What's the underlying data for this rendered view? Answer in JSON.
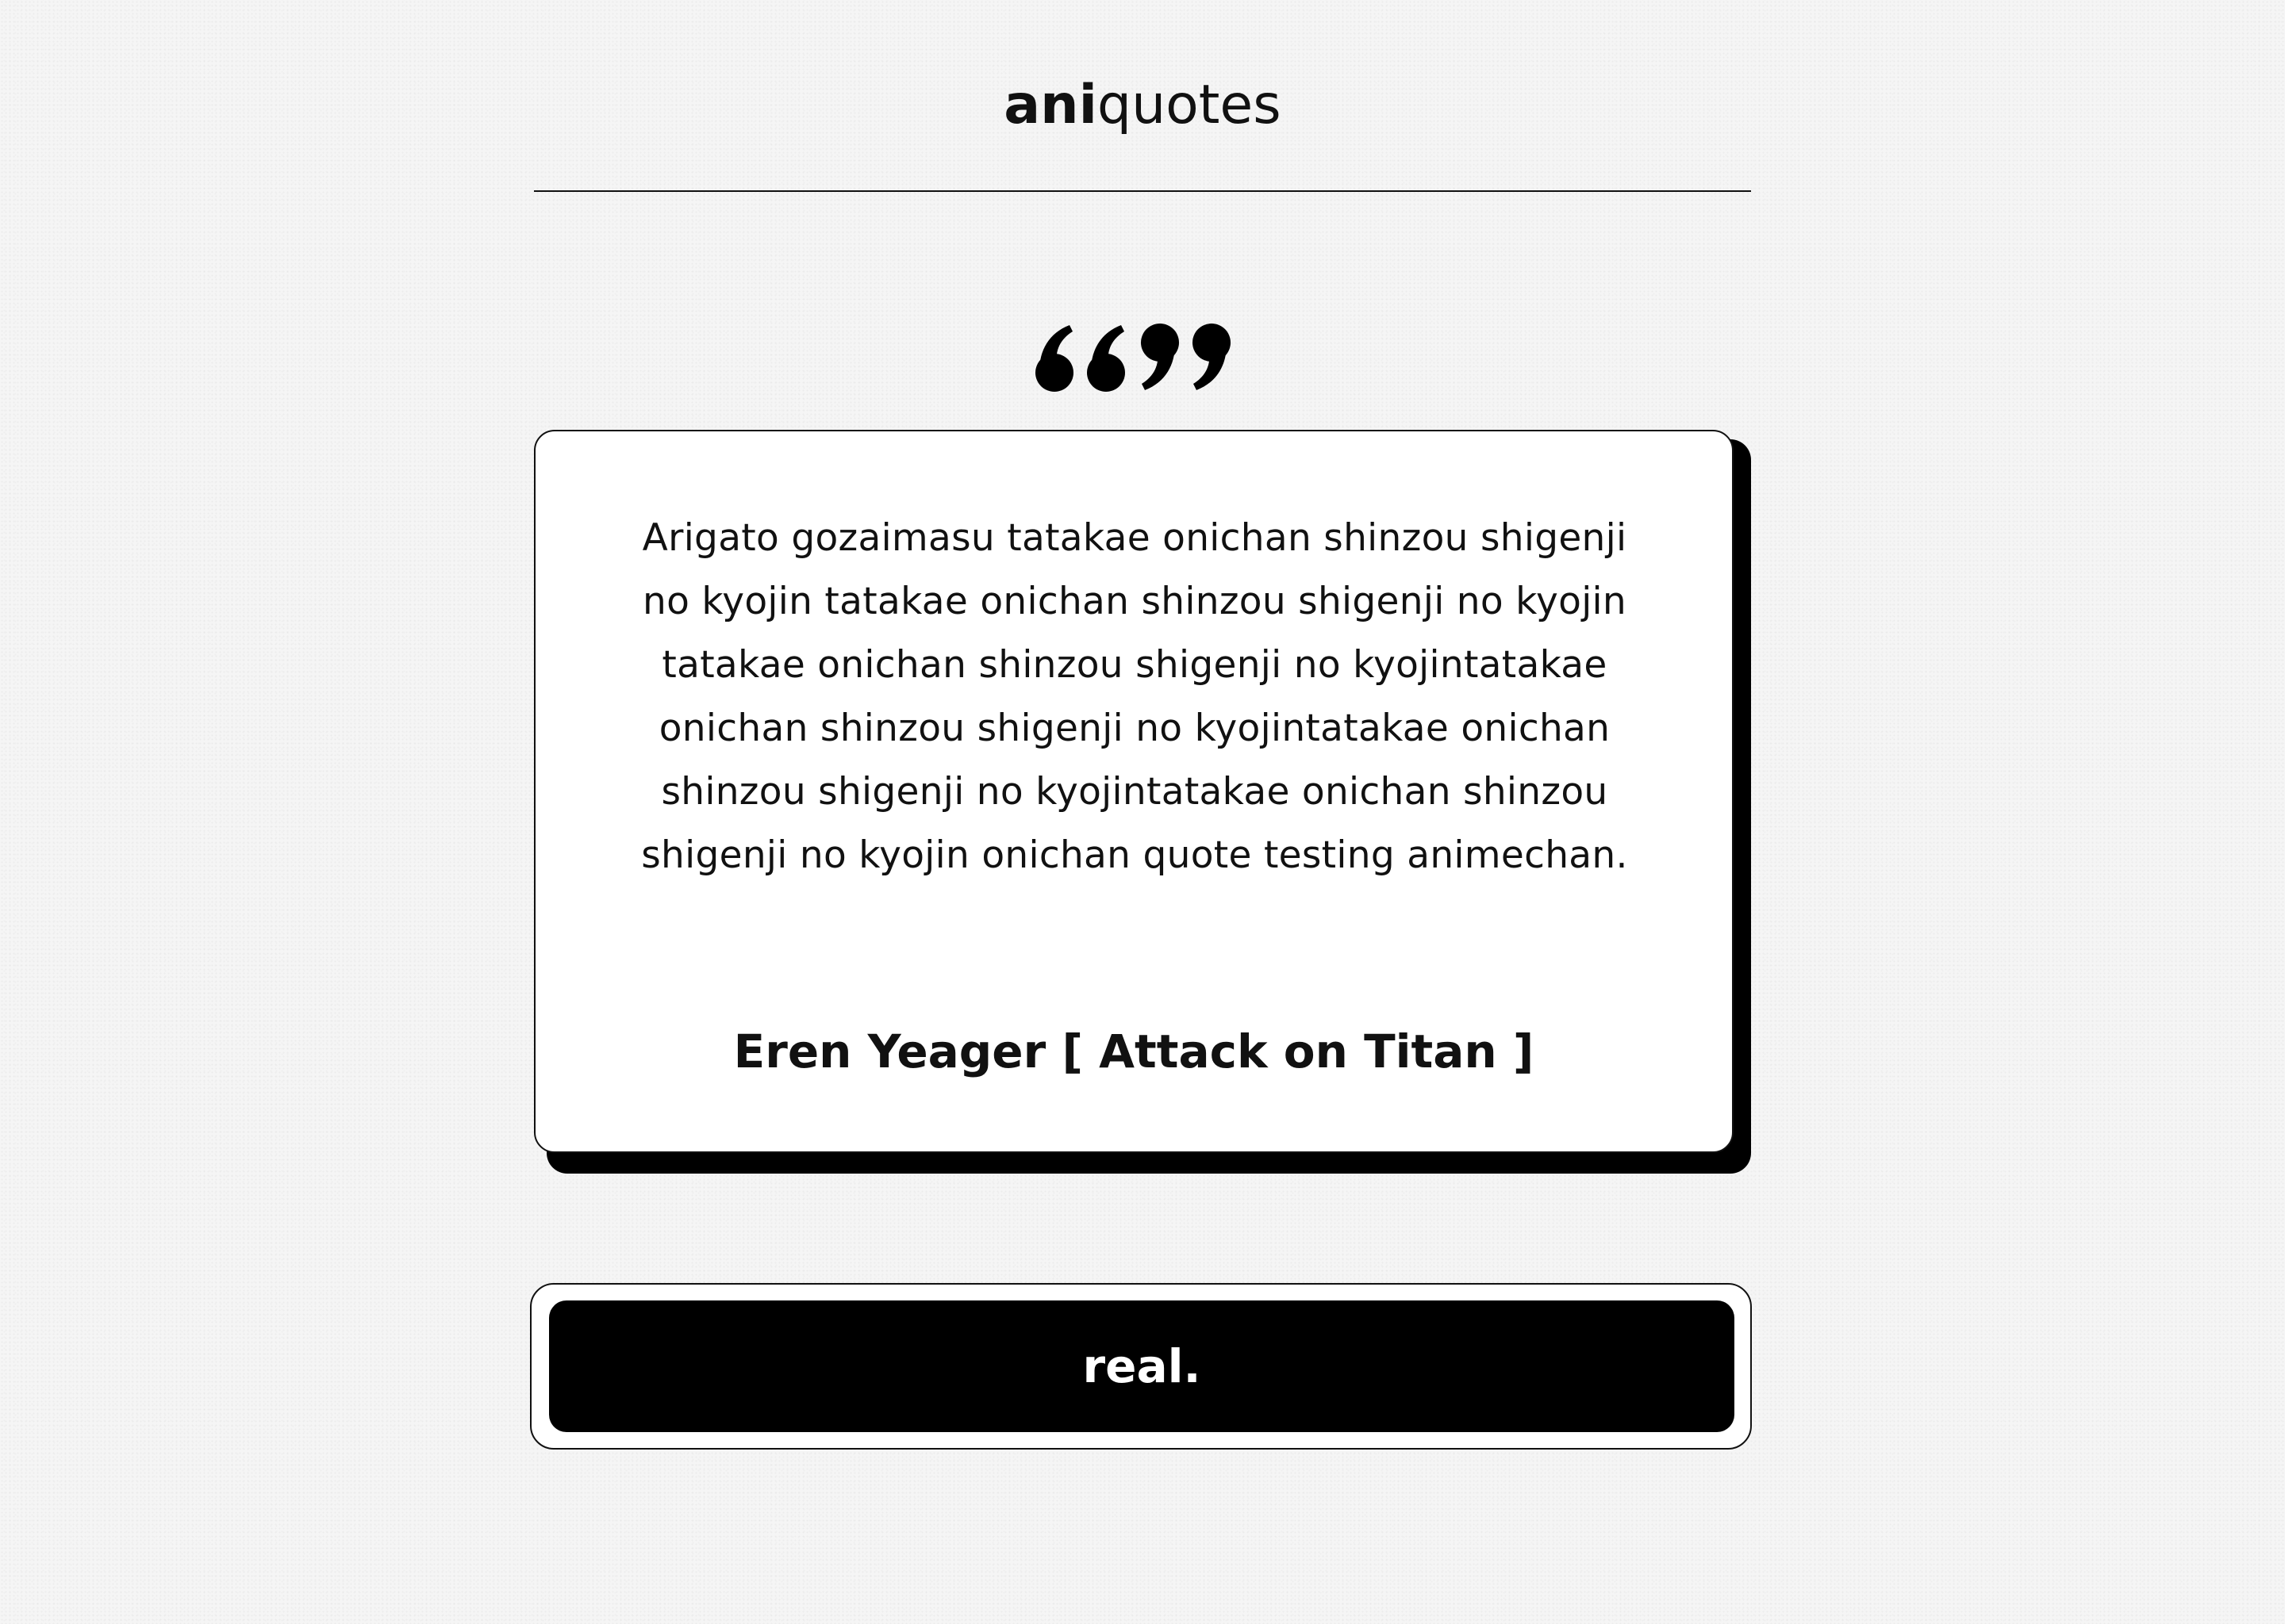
{
  "brand": {
    "strong": "ani",
    "light": "quotes"
  },
  "quote_icon": "double-quote-icon",
  "quote": {
    "text": "Arigato gozaimasu tatakae onichan shinzou shigenji no kyojin tatakae onichan shinzou shigenji no kyojin tatakae onichan shinzou shigenji no kyojintatakae onichan shinzou shigenji no kyojintatakae onichan shinzou shigenji no kyojintatakae onichan shinzou shigenji no kyojin onichan quote testing animechan.",
    "attribution": "Eren Yeager [ Attack on Titan ]"
  },
  "action": {
    "label": "real."
  },
  "colors": {
    "background": "#f5f5f5",
    "ink": "#000000",
    "card": "#ffffff"
  }
}
